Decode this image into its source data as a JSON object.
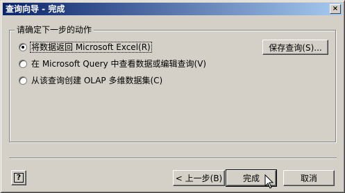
{
  "window": {
    "title": "查询向导 - 完成",
    "close_glyph": "×"
  },
  "group": {
    "label": "请确定下一步的动作"
  },
  "options": [
    {
      "label": "将数据返回 Microsoft Excel(R)",
      "checked": true
    },
    {
      "label": "在 Microsoft Query 中查看数据或编辑查询(V)",
      "checked": false
    },
    {
      "label": "从该查询创建 OLAP 多维数据集(C)",
      "checked": false
    }
  ],
  "buttons": {
    "save_query": "保存查询(S)...",
    "help": "?",
    "back": "< 上一步(B)",
    "finish": "完成",
    "cancel": "取消"
  }
}
